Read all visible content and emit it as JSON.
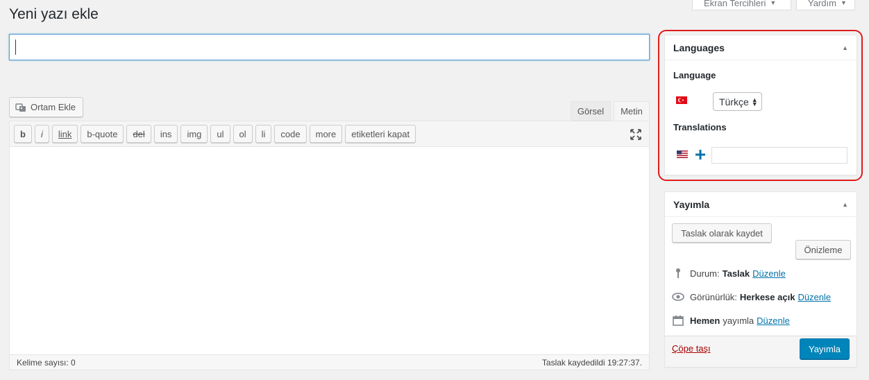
{
  "page": {
    "title": "Yeni yazı ekle"
  },
  "top_tabs": {
    "screen_options": "Ekran Tercihleri",
    "help": "Yardım"
  },
  "title_input": {
    "value": "",
    "placeholder": ""
  },
  "media_button": {
    "label": "Ortam Ekle"
  },
  "editor": {
    "tabs": {
      "visual": "Görsel",
      "text": "Metin"
    },
    "quicktags": [
      "b",
      "i",
      "link",
      "b-quote",
      "del",
      "ins",
      "img",
      "ul",
      "ol",
      "li",
      "code",
      "more",
      "etiketleri kapat"
    ],
    "word_count": "Kelime sayısı: 0",
    "draft_saved": "Taslak kaydedildi 19:27:37."
  },
  "languages_box": {
    "title": "Languages",
    "language_label": "Language",
    "selected_language": "Türkçe",
    "translations_label": "Translations",
    "translation_value": ""
  },
  "publish_box": {
    "title": "Yayımla",
    "save_draft": "Taslak olarak kaydet",
    "preview": "Önizleme",
    "status_label": "Durum:",
    "status_value": "Taslak",
    "visibility_label": "Görünürlük:",
    "visibility_value": "Herkese açık",
    "schedule_strong": "Hemen",
    "schedule_rest": "yayımla",
    "edit_link": "Düzenle",
    "trash": "Çöpe taşı",
    "publish": "Yayımla"
  },
  "colors": {
    "accent": "#0085ba",
    "link": "#0073aa",
    "highlight": "#e01b1b",
    "trash": "#aa0000"
  }
}
